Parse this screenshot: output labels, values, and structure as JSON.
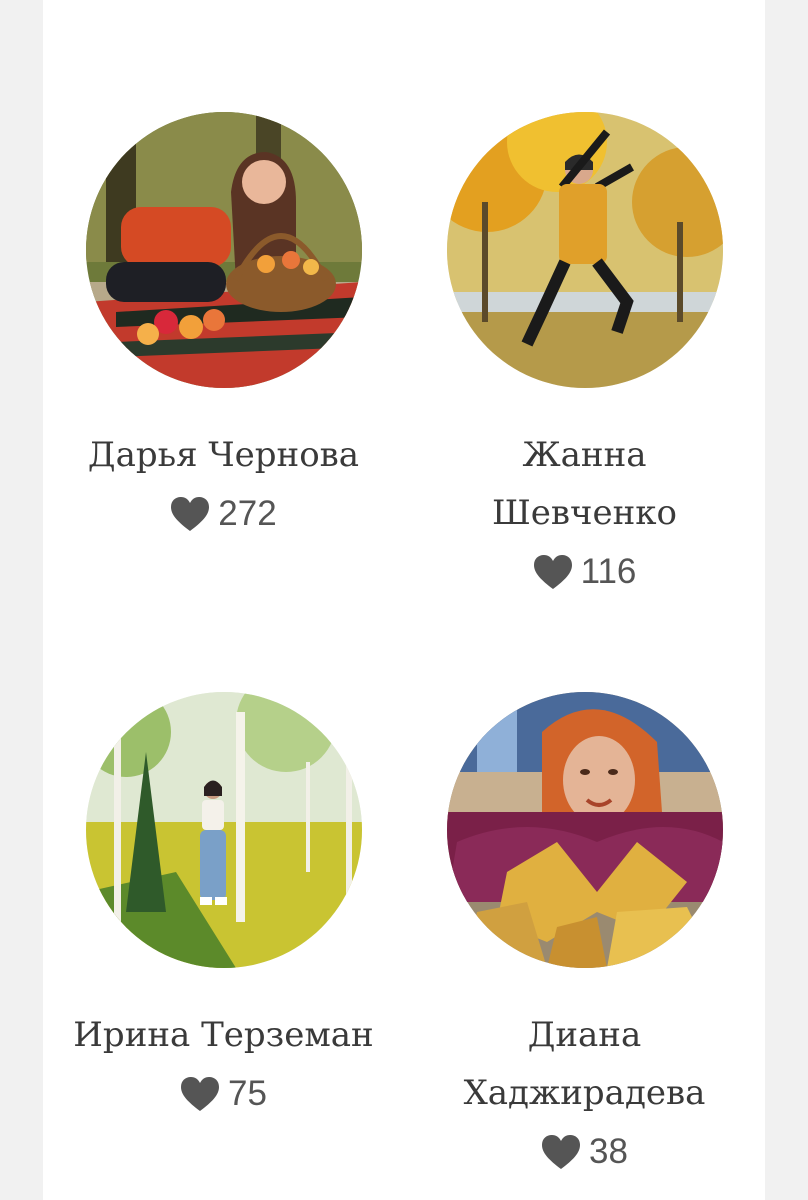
{
  "icons": {
    "like": "heart-icon"
  },
  "colors": {
    "heart": "#555555",
    "name": "#3a3a3a"
  },
  "cards": [
    {
      "name_lines": [
        "Дарья Чернова"
      ],
      "likes": "272"
    },
    {
      "name_lines": [
        "Жанна",
        "Шевченко"
      ],
      "likes": "116"
    },
    {
      "name_lines": [
        "Ирина Терземан"
      ],
      "likes": "75"
    },
    {
      "name_lines": [
        "Диана",
        "Хаджирадева"
      ],
      "likes": "38"
    }
  ]
}
